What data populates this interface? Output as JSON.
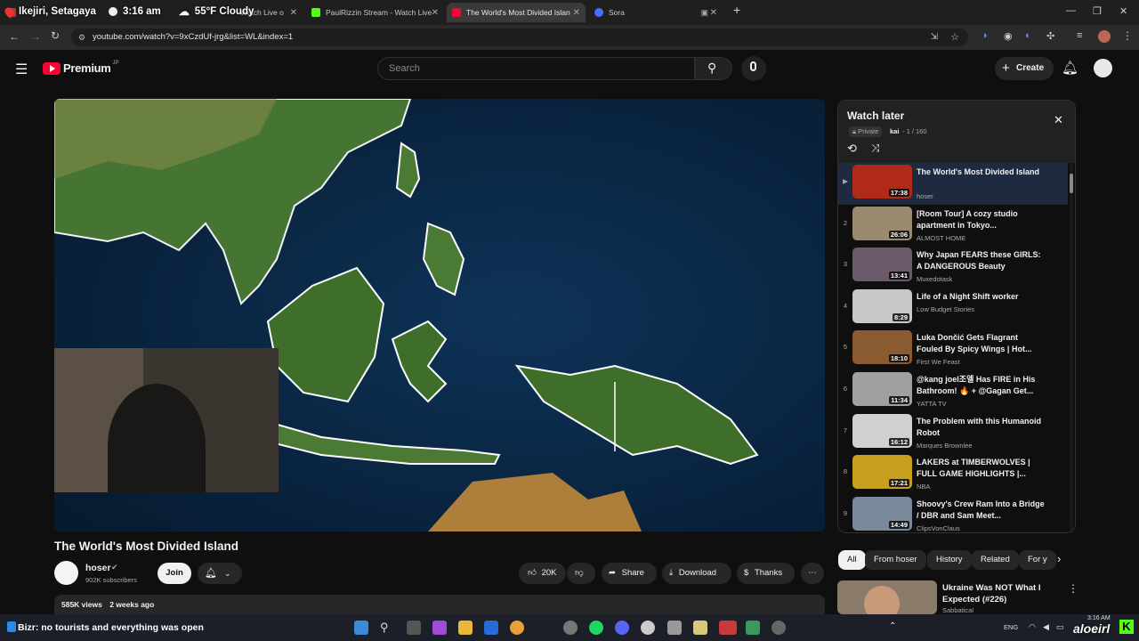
{
  "stream_overlay": {
    "location": "Ikejiri, Setagaya",
    "time": "3:16 am",
    "weather": "55°F Cloudy"
  },
  "browser": {
    "tabs": [
      {
        "label": "Watch Live o",
        "active": false
      },
      {
        "label": "PaulRizzin Stream - Watch Live",
        "active": false
      },
      {
        "label": "The World's Most Divided Islan",
        "active": true
      },
      {
        "label": "Sora",
        "active": false
      }
    ],
    "url": "youtube.com/watch?v=9xCzdUf-jrg&list=WL&index=1"
  },
  "youtube": {
    "brand": "Premium",
    "region": "JP",
    "search_placeholder": "Search",
    "create_label": "Create"
  },
  "video": {
    "title": "The World's Most Divided Island",
    "channel": "hoser",
    "subscribers": "902K subscribers",
    "join_label": "Join",
    "likes": "20K",
    "share_label": "Share",
    "download_label": "Download",
    "thanks_label": "Thanks",
    "views": "585K views",
    "age": "2 weeks ago"
  },
  "playlist": {
    "title": "Watch later",
    "privacy": "Private",
    "owner": "kai",
    "position": "1 / 160",
    "items": [
      {
        "index": "▶",
        "title": "The World's Most Divided Island",
        "channel": "hoser",
        "duration": "17:38",
        "color": "#b02a1a"
      },
      {
        "index": "2",
        "title": "[Room Tour] A cozy studio apartment in Tokyo...",
        "channel": "ALMOST HOME",
        "duration": "26:06",
        "color": "#9a8a70"
      },
      {
        "index": "3",
        "title": "Why Japan FEARS these GIRLS: A DANGEROUS Beauty",
        "channel": "Muxedotask",
        "duration": "13:41",
        "color": "#6a5a6a"
      },
      {
        "index": "4",
        "title": "Life of a Night Shift worker",
        "channel": "Low Budget Stories",
        "duration": "8:29",
        "color": "#c8c8c8"
      },
      {
        "index": "5",
        "title": "Luka Dončić Gets Flagrant Fouled By Spicy Wings | Hot...",
        "channel": "First We Feast",
        "duration": "18:10",
        "color": "#8a5a30"
      },
      {
        "index": "6",
        "title": "@kang joel조엘 Has FIRE in His Bathroom! 🔥 + @Gagan Get...",
        "channel": "YATTA TV",
        "duration": "11:34",
        "color": "#a0a0a0"
      },
      {
        "index": "7",
        "title": "The Problem with this Humanoid Robot",
        "channel": "Marques Brownlee",
        "duration": "16:12",
        "color": "#d0d0d0"
      },
      {
        "index": "8",
        "title": "LAKERS at TIMBERWOLVES | FULL GAME HIGHLIGHTS |...",
        "channel": "NBA",
        "duration": "17:21",
        "color": "#c8a020"
      },
      {
        "index": "9",
        "title": "Shoovy's Crew Ram Into a Bridge / DBR and Sam Meet...",
        "channel": "ClipsVonClaus",
        "duration": "14:49",
        "color": "#7a8a9a"
      }
    ]
  },
  "chips": [
    "All",
    "From hoser",
    "History",
    "Related",
    "For y"
  ],
  "related": {
    "title": "Ukraine Was NOT What I Expected (#226)",
    "channel": "Sabbatical"
  },
  "stream_caption": "Bizr: no tourists and everything was open",
  "taskbar": {
    "language": "ENG",
    "clock": "3:16 AM",
    "watermark": "aloeirl"
  },
  "colors": {
    "youtube_red": "#ff0033",
    "background": "#0f0f0f",
    "ocean": "#0b2a47",
    "land": "#3f6e2a"
  }
}
